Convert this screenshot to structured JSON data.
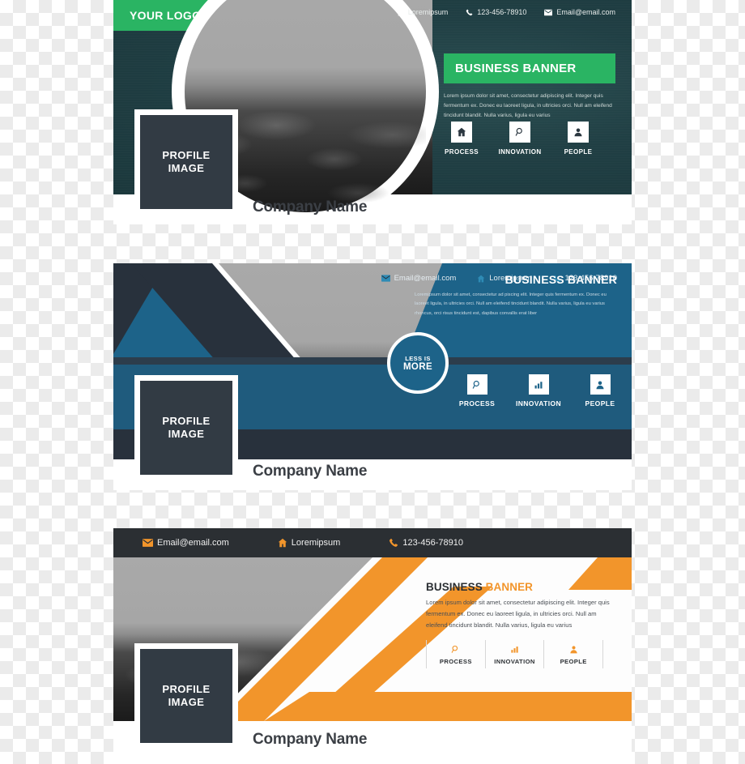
{
  "banners": [
    {
      "id": "banner-green",
      "logo": "YOUR LOGO",
      "title": "BUSINESS BANNER",
      "body": "Lorem ipsum dolor sit amet, consectetur adipiscing elit. Integer quis fermentum ex. Donec eu laoreet ligula, in ultricies orci. Null am eleifend tincidunt blandit. Nulla varius, ligula eu varius",
      "profile_line1": "PROFILE",
      "profile_line2": "IMAGE",
      "company_name": "Company Name",
      "contacts": [
        {
          "icon": "home-icon",
          "text": "Loremipsum"
        },
        {
          "icon": "phone-icon",
          "text": "123-456-78910"
        },
        {
          "icon": "envelope-icon",
          "text": "Email@email.com"
        }
      ],
      "features": [
        {
          "icon": "home-icon",
          "label": "PROCESS"
        },
        {
          "icon": "search-icon",
          "label": "INNOVATION"
        },
        {
          "icon": "person-icon",
          "label": "PEOPLE"
        }
      ],
      "colors": {
        "accent": "#2ab463",
        "background": "#1f3f44",
        "profile": "#323b44"
      }
    },
    {
      "id": "banner-blue",
      "title": "BUSINESS BANNER",
      "body": "Loremipsum dolor sit amet, consectetur ad piscing elit. Integer quis fermentum ex. Donec eu laoreet ligula, in ultricies orci. Null am eleifend tincidunt blandit. Nulla varius, ligula eu varius rhoncus, orci risus tincidunt est, dapibus convallis erat liber",
      "badge_line1": "LESS IS",
      "badge_line2": "MORE",
      "profile_line1": "PROFILE",
      "profile_line2": "IMAGE",
      "company_name": "Company Name",
      "contacts": [
        {
          "icon": "envelope-icon",
          "text": "Email@email.com"
        },
        {
          "icon": "home-icon",
          "text": "Loremipsum"
        },
        {
          "icon": "phone-icon",
          "text": "123-456-78910"
        }
      ],
      "features": [
        {
          "icon": "search-icon",
          "label": "PROCESS"
        },
        {
          "icon": "chart-icon",
          "label": "INNOVATION"
        },
        {
          "icon": "person-icon",
          "label": "PEOPLE"
        }
      ],
      "colors": {
        "accent": "#1d6389",
        "dark": "#28313c",
        "profile": "#323b44"
      }
    },
    {
      "id": "banner-orange",
      "title_part1": "BUSINESS ",
      "title_part2": "BANNER",
      "body": "Lorem ipsum dolor sit amet, consectetur adipiscing elit. Integer quis fermentum ex. Donec eu laoreet ligula, in ultricies orci. Null am eleifend tincidunt blandit. Nulla varius, ligula eu varius",
      "profile_line1": "PROFILE",
      "profile_line2": "IMAGE",
      "company_name": "Company Name",
      "contacts": [
        {
          "icon": "envelope-icon",
          "text": "Email@email.com"
        },
        {
          "icon": "home-icon",
          "text": "Loremipsum"
        },
        {
          "icon": "phone-icon",
          "text": "123-456-78910"
        }
      ],
      "features": [
        {
          "icon": "search-icon",
          "label": "PROCESS"
        },
        {
          "icon": "chart-icon",
          "label": "INNOVATION"
        },
        {
          "icon": "person-icon",
          "label": "PEOPLE"
        }
      ],
      "colors": {
        "accent": "#f2952b",
        "topbar": "#2b2f33",
        "profile": "#323b44"
      }
    }
  ]
}
